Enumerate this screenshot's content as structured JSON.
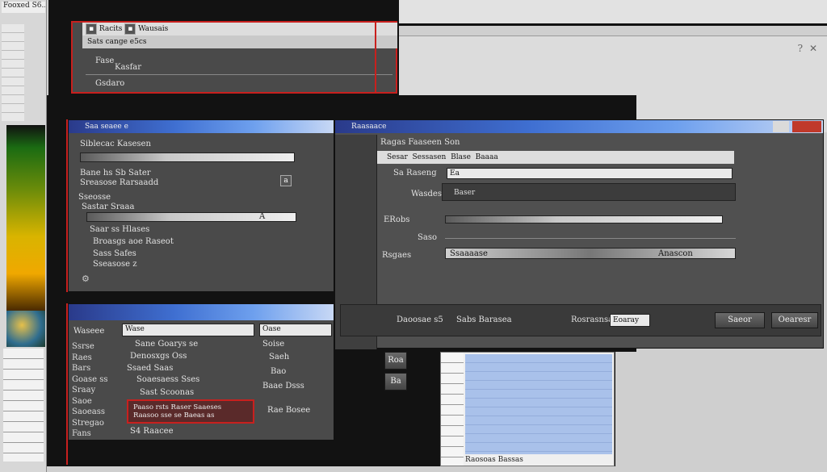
{
  "left_panel": {
    "title": "Fooxed S6..."
  },
  "top_dialog": {
    "tab1": "Racits",
    "tab2": "Wausais",
    "header": "Sats cange e5cs",
    "field1": "Fase",
    "field2": "Kasfar",
    "item": "Gsdaro"
  },
  "mid_dialog": {
    "title": "Saa seaee e",
    "section": "Siblecac Kasesen",
    "line1": "Bane hs Sb Sater",
    "line2": "Sreasose Rarsaadd",
    "group": "Sseosse",
    "field_label": "Sastar Sraaa",
    "field_value": "A",
    "sub1": "Saar ss Hlases",
    "sub2": "Broasgs aoe Raseot",
    "sub3": "Sass Safes",
    "sub4": "Sseasose z"
  },
  "main_dialog": {
    "title": "Raasaace",
    "header": "Ragas Faaseen Son",
    "col1": "Sesar",
    "col2": "Sessasen",
    "col3": "Blase",
    "col4": "Baaaa",
    "row1_label": "Sa Raseng",
    "row1_value": "Ea",
    "row2_label": "Wasdes",
    "row2_value": "Baser",
    "row3_label": "ERobs",
    "row4_label": "Saso",
    "row5_label": "Rsgaes",
    "row5_value": "Ssaaaase",
    "row5_right": "Anascon",
    "footer_left": "Daoosae s5",
    "footer_mid": "Sabs Barasea",
    "footer_label": "Rosrasnsa",
    "footer_value": "Eoaray",
    "ok": "Saeor",
    "cancel": "Oearesr"
  },
  "lower_dialog": {
    "label1": "Waseee",
    "field1": "Wase",
    "items": [
      "Ssrse",
      "Raes",
      "Bars",
      "Goase ss",
      "Sraay",
      "Saoe",
      "Saoeass",
      "Stregao",
      "Fans"
    ],
    "sub1": "Sane Goarys se",
    "sub2": "Denosxgs Oss",
    "sub3": "Ssaed Saas",
    "sub4": "Soaesaess Sses",
    "sub5": "Sast Scoonas",
    "alert": "Paaso rsts Raser Saaeses",
    "alert2": "Raasoo sse se Baeas as",
    "right_field": "Oase",
    "right1": "Soise",
    "right2": "Saeh",
    "right3": "Bao",
    "right4": "Baae Dsss",
    "right5": "Rae Bosee",
    "footer": "S4 Raacee"
  },
  "blue_panel": {
    "footer": "Raosoas Bassas"
  },
  "side_buttons": {
    "b1": "Roa",
    "b2": "Ba"
  }
}
